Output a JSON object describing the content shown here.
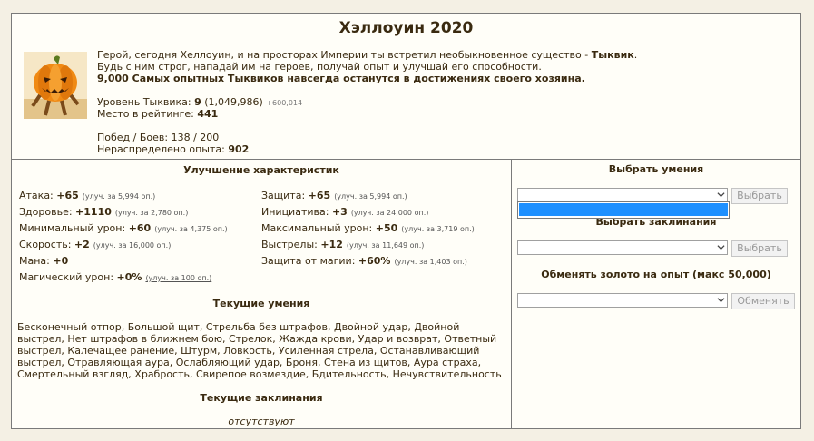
{
  "title": "Хэллоуин 2020",
  "intro": {
    "line1_a": "Герой, сегодня Хеллоуин, и на просторах Империи ты встретил необыкновенное существо - ",
    "line1_b": "Тыквик",
    "line1_c": ".",
    "line2": "Будь с ним строг, нападай им на героев, получай опыт и улучшай его способности.",
    "line3": "9,000 Самых опытных Тыквиков навсегда останутся в достижениях своего хозяина."
  },
  "level": {
    "label": "Уровень Тыквика: ",
    "value": "9",
    "exp": " (1,049,986)",
    "delta": "+600,014"
  },
  "rank": {
    "label": "Место в рейтинге: ",
    "value": "441"
  },
  "wins": {
    "label": "Побед / Боев: ",
    "value": "138 / 200"
  },
  "unspent": {
    "label": "Нераспределено опыта: ",
    "value": "902"
  },
  "upgrade_title": "Улучшение характеристик",
  "stats": [
    {
      "label": "Атака: ",
      "value": "+65",
      "hint": "(улуч. за 5,994 оп.)"
    },
    {
      "label": "Защита: ",
      "value": "+65",
      "hint": "(улуч. за 5,994 оп.)"
    },
    {
      "label": "Здоровье: ",
      "value": "+1110",
      "hint": "(улуч. за 2,780 оп.)"
    },
    {
      "label": "Инициатива: ",
      "value": "+3",
      "hint": "(улуч. за 24,000 оп.)"
    },
    {
      "label": "Минимальный урон: ",
      "value": "+60",
      "hint": "(улуч. за 4,375 оп.)"
    },
    {
      "label": "Максимальный урон: ",
      "value": "+50",
      "hint": "(улуч. за 3,719 оп.)"
    },
    {
      "label": "Скорость: ",
      "value": "+2",
      "hint": "(улуч. за 16,000 оп.)"
    },
    {
      "label": "Выстрелы: ",
      "value": "+12",
      "hint": "(улуч. за 11,649 оп.)"
    },
    {
      "label": "Мана: ",
      "value": "+0",
      "hint": ""
    },
    {
      "label": "Защита от магии: ",
      "value": "+60%",
      "hint": "(улуч. за 1,403 оп.)"
    },
    {
      "label": "Магический урон: ",
      "value": "+0%",
      "hint": "(улуч. за 100 оп.)"
    }
  ],
  "skills_title": "Текущие умения",
  "skills_text": "Бесконечный отпор, Большой щит, Стрельба без штрафов, Двойной удар, Двойной выстрел, Нет штрафов в ближнем бою, Стрелок, Жажда крови, Удар и возврат, Ответный выстрел, Калечащее ранение, Штурм, Ловкость, Усиленная стрела, Останавливающий выстрел, Отравляющая аура, Ослабляющий удар, Броня, Стена из щитов, Аура страха, Смертельный взгляд, Храбрость, Свирепое возмездие, Бдительность, Нечувствительность",
  "spells_title": "Текущие заклинания",
  "spells_text": "отсутствуют",
  "right": {
    "choose_skill": "Выбрать умения",
    "choose_spell": "Выбрать заклинания",
    "exchange": "Обменять золото на опыт (макс 50,000)",
    "btn_choose": "Выбрать",
    "btn_exchange": "Обменять"
  }
}
